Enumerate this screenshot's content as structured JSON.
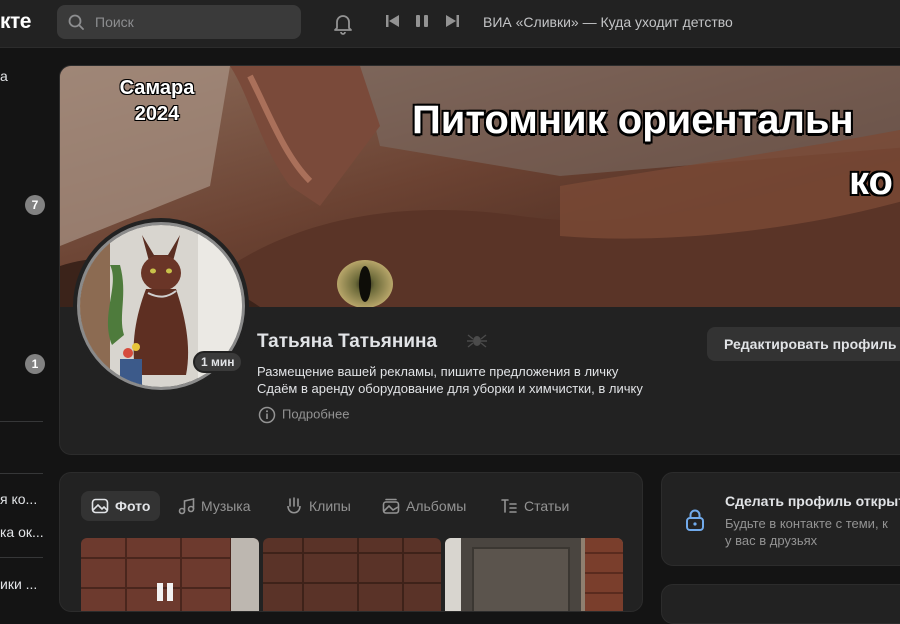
{
  "header": {
    "logo_text": "кте",
    "search_placeholder": "Поиск",
    "now_playing": "ВИА «Сливки» — Куда уходит детство"
  },
  "sidebar": {
    "item_top": "а",
    "badge_1": "7",
    "badge_2": "1",
    "list_items": [
      "я ко...",
      "ка ок...",
      "ики ..."
    ]
  },
  "profile": {
    "cover_city": "Самара",
    "cover_year": "2024",
    "cover_title_line1": "Питомник ориентальн",
    "cover_title_line2": "ко",
    "name": "Татьяна Татьянина",
    "online": "1 мин",
    "status_line1": "Размещение вашей рекламы, пишите предложения в личку",
    "status_line2": "Сдаём в аренду оборудование для уборки и химчистки, в личку",
    "more_label": "Подробнее",
    "edit_button": "Редактировать профиль"
  },
  "media_tabs": {
    "photo": "Фото",
    "music": "Музыка",
    "clips": "Клипы",
    "albums": "Альбомы",
    "articles": "Статьи"
  },
  "privacy": {
    "title": "Сделать профиль открыт",
    "text_line1": "Будьте в контакте с теми, к",
    "text_line2": "у вас в друзьях"
  },
  "colors": {
    "background": "#141414",
    "card": "#222222",
    "accent_lock": "#71aaeb"
  }
}
